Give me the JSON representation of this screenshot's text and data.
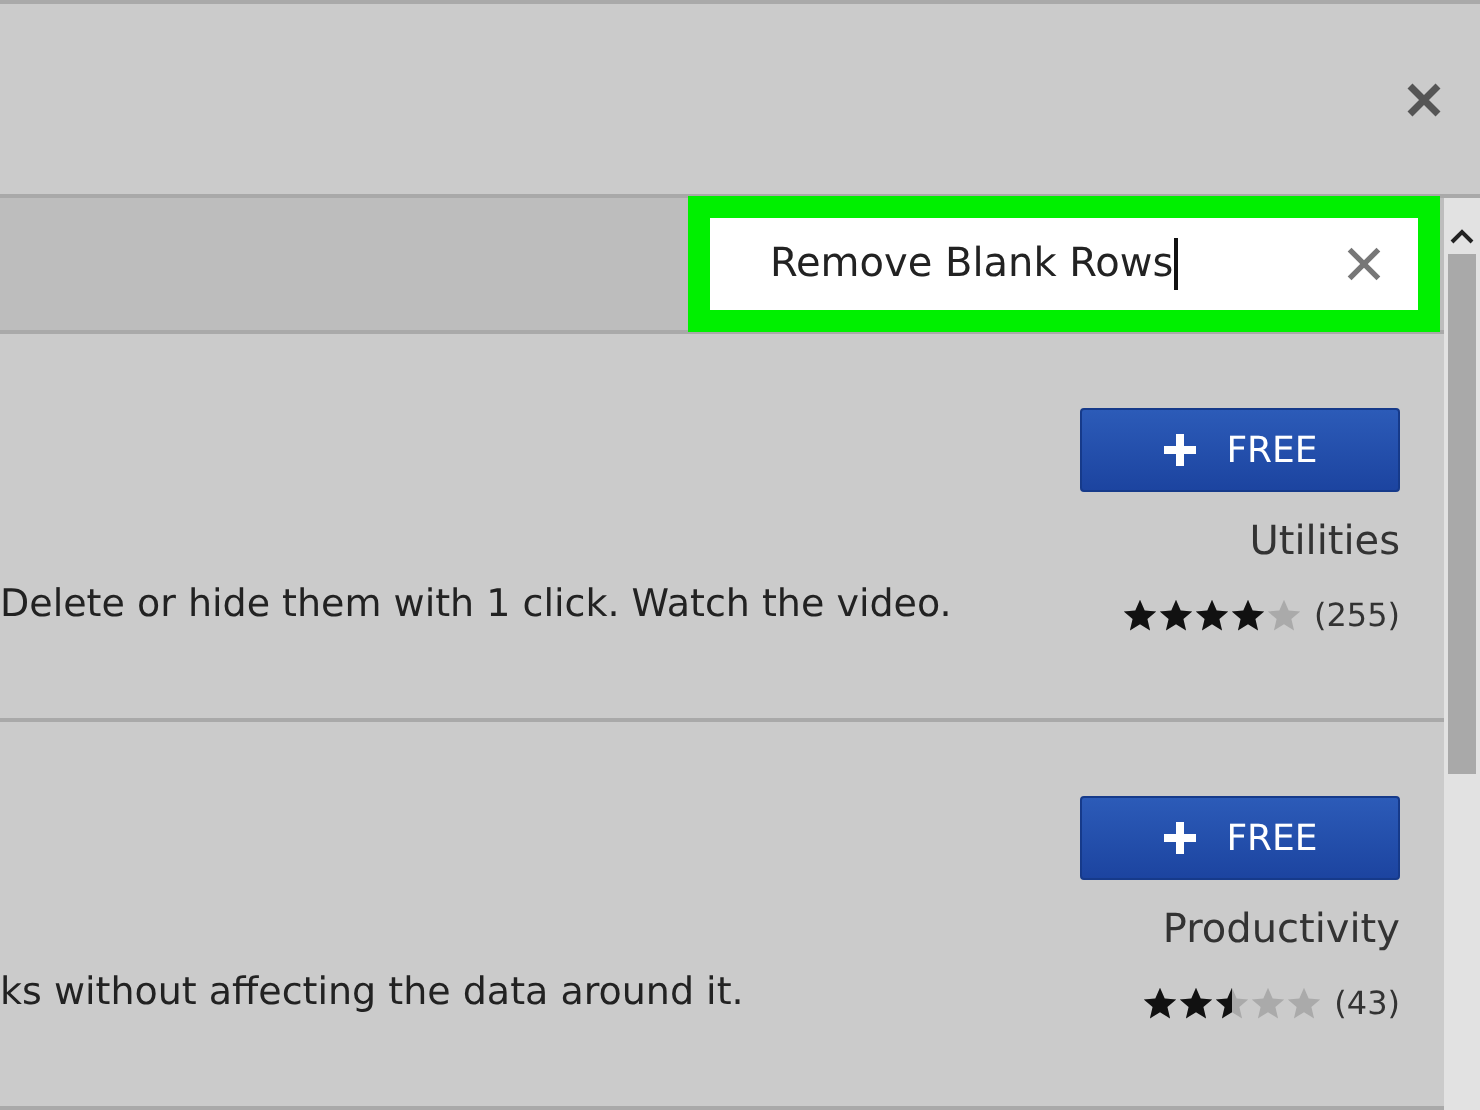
{
  "search": {
    "value": "Remove Blank Rows",
    "highlighted": true
  },
  "items": [
    {
      "button": "FREE",
      "category": "Utilities",
      "description": "Delete or hide them with 1 click. Watch the video.",
      "stars": 4,
      "count": "(255)"
    },
    {
      "button": "FREE",
      "category": "Productivity",
      "description": "ks without affecting the data around it.",
      "stars": 2.5,
      "count": "(43)"
    }
  ]
}
